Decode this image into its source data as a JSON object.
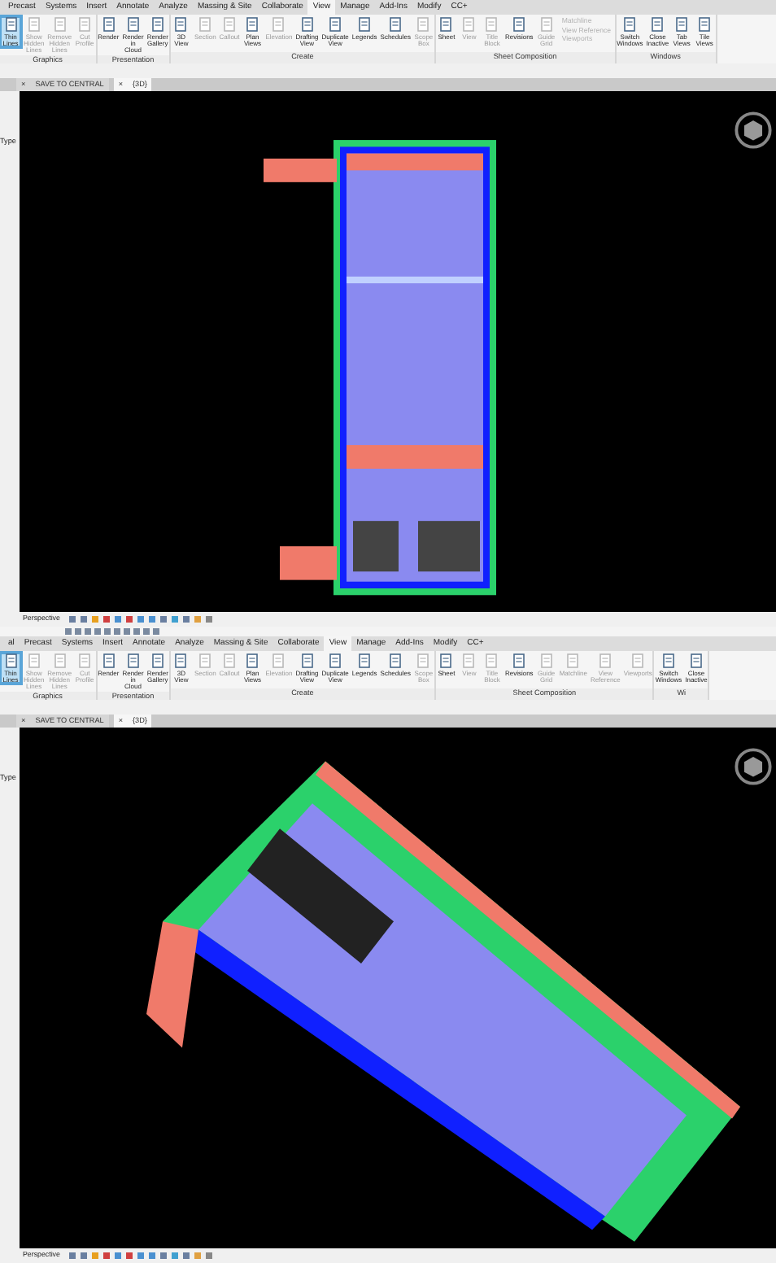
{
  "panels": [
    {
      "quick_access_bar": false,
      "ribbon_tabs": [
        {
          "label": "Precast",
          "selected": false
        },
        {
          "label": "Systems",
          "selected": false
        },
        {
          "label": "Insert",
          "selected": false
        },
        {
          "label": "Annotate",
          "selected": false
        },
        {
          "label": "Analyze",
          "selected": false
        },
        {
          "label": "Massing & Site",
          "selected": false
        },
        {
          "label": "Collaborate",
          "selected": false
        },
        {
          "label": "View",
          "selected": true
        },
        {
          "label": "Manage",
          "selected": false
        },
        {
          "label": "Add-Ins",
          "selected": false
        },
        {
          "label": "Modify",
          "selected": false
        },
        {
          "label": "CC+",
          "selected": false
        }
      ],
      "groups": [
        {
          "label": "Graphics",
          "buttons": [
            {
              "label": "Thin Lines",
              "kind": "large",
              "disabled": false,
              "on": true
            },
            {
              "label": "Show Hidden Lines",
              "kind": "large",
              "disabled": true,
              "on": false
            },
            {
              "label": "Remove Hidden Lines",
              "kind": "large",
              "disabled": true,
              "on": false
            },
            {
              "label": "Cut Profile",
              "kind": "large",
              "disabled": true,
              "on": false
            }
          ]
        },
        {
          "label": "Presentation",
          "buttons": [
            {
              "label": "Render",
              "kind": "large",
              "disabled": false,
              "on": false
            },
            {
              "label": "Render in Cloud",
              "kind": "large",
              "disabled": false,
              "on": false
            },
            {
              "label": "Render Gallery",
              "kind": "large",
              "disabled": false,
              "on": false
            }
          ]
        },
        {
          "label": "Create",
          "buttons": [
            {
              "label": "3D View",
              "kind": "large",
              "disabled": false,
              "on": false
            },
            {
              "label": "Section",
              "kind": "large",
              "disabled": true,
              "on": false
            },
            {
              "label": "Callout",
              "kind": "large",
              "disabled": true,
              "on": false
            },
            {
              "label": "Plan Views",
              "kind": "large",
              "disabled": false,
              "on": false
            },
            {
              "label": "Elevation",
              "kind": "large",
              "disabled": true,
              "on": false
            },
            {
              "label": "Drafting View",
              "kind": "large",
              "disabled": false,
              "on": false
            },
            {
              "label": "Duplicate View",
              "kind": "large",
              "disabled": false,
              "on": false
            },
            {
              "label": "Legends",
              "kind": "large",
              "disabled": false,
              "on": false
            },
            {
              "label": "Schedules",
              "kind": "large",
              "disabled": false,
              "on": false
            },
            {
              "label": "Scope Box",
              "kind": "large",
              "disabled": true,
              "on": false
            }
          ]
        },
        {
          "label": "Sheet Composition",
          "buttons": [
            {
              "label": "Sheet",
              "kind": "large",
              "disabled": false,
              "on": false
            },
            {
              "label": "View",
              "kind": "large",
              "disabled": true,
              "on": false
            },
            {
              "label": "Title Block",
              "kind": "large",
              "disabled": true,
              "on": false
            },
            {
              "label": "Revisions",
              "kind": "large",
              "disabled": false,
              "on": false
            },
            {
              "label": "Guide Grid",
              "kind": "large",
              "disabled": true,
              "on": false
            },
            {
              "label": "Matchline",
              "kind": "small",
              "disabled": true,
              "on": false
            },
            {
              "label": "View Reference",
              "kind": "small",
              "disabled": true,
              "on": false
            },
            {
              "label": "Viewports",
              "kind": "small",
              "disabled": true,
              "on": false
            }
          ]
        },
        {
          "label": "Windows",
          "buttons": [
            {
              "label": "Switch Windows",
              "kind": "large",
              "disabled": false,
              "on": false
            },
            {
              "label": "Close Inactive",
              "kind": "large",
              "disabled": false,
              "on": false
            },
            {
              "label": "Tab Views",
              "kind": "large",
              "disabled": false,
              "on": false
            },
            {
              "label": "Tile Views",
              "kind": "large",
              "disabled": false,
              "on": false
            }
          ]
        }
      ],
      "view_tabs": [
        {
          "label": "SAVE TO CENTRAL",
          "close": "×",
          "selected": false
        },
        {
          "label": "{3D}",
          "close": "×",
          "selected": true
        }
      ],
      "properties_label": "Type",
      "kind": "plan",
      "status_bar": {
        "view_style": "Perspective"
      }
    },
    {
      "quick_access_bar": true,
      "ribbon_tabs": [
        {
          "label": "al",
          "selected": false
        },
        {
          "label": "Precast",
          "selected": false
        },
        {
          "label": "Systems",
          "selected": false
        },
        {
          "label": "Insert",
          "selected": false
        },
        {
          "label": "Annotate",
          "selected": false
        },
        {
          "label": "Analyze",
          "selected": false
        },
        {
          "label": "Massing & Site",
          "selected": false
        },
        {
          "label": "Collaborate",
          "selected": false
        },
        {
          "label": "View",
          "selected": true
        },
        {
          "label": "Manage",
          "selected": false
        },
        {
          "label": "Add-Ins",
          "selected": false
        },
        {
          "label": "Modify",
          "selected": false
        },
        {
          "label": "CC+",
          "selected": false
        }
      ],
      "groups": [
        {
          "label": "Graphics",
          "buttons": [
            {
              "label": "Thin Lines",
              "kind": "large",
              "disabled": false,
              "on": true
            },
            {
              "label": "Show Hidden Lines",
              "kind": "large",
              "disabled": true,
              "on": false
            },
            {
              "label": "Remove Hidden Lines",
              "kind": "large",
              "disabled": true,
              "on": false
            },
            {
              "label": "Cut Profile",
              "kind": "large",
              "disabled": true,
              "on": false
            }
          ]
        },
        {
          "label": "Presentation",
          "buttons": [
            {
              "label": "Render",
              "kind": "large",
              "disabled": false,
              "on": false
            },
            {
              "label": "Render in Cloud",
              "kind": "large",
              "disabled": false,
              "on": false
            },
            {
              "label": "Render Gallery",
              "kind": "large",
              "disabled": false,
              "on": false
            }
          ]
        },
        {
          "label": "Create",
          "buttons": [
            {
              "label": "3D View",
              "kind": "large",
              "disabled": false,
              "on": false
            },
            {
              "label": "Section",
              "kind": "large",
              "disabled": true,
              "on": false
            },
            {
              "label": "Callout",
              "kind": "large",
              "disabled": true,
              "on": false
            },
            {
              "label": "Plan Views",
              "kind": "large",
              "disabled": false,
              "on": false
            },
            {
              "label": "Elevation",
              "kind": "large",
              "disabled": true,
              "on": false
            },
            {
              "label": "Drafting View",
              "kind": "large",
              "disabled": false,
              "on": false
            },
            {
              "label": "Duplicate View",
              "kind": "large",
              "disabled": false,
              "on": false
            },
            {
              "label": "Legends",
              "kind": "large",
              "disabled": false,
              "on": false
            },
            {
              "label": "Schedules",
              "kind": "large",
              "disabled": false,
              "on": false
            },
            {
              "label": "Scope Box",
              "kind": "large",
              "disabled": true,
              "on": false
            }
          ]
        },
        {
          "label": "Sheet Composition",
          "buttons": [
            {
              "label": "Sheet",
              "kind": "large",
              "disabled": false,
              "on": false
            },
            {
              "label": "View",
              "kind": "large",
              "disabled": true,
              "on": false
            },
            {
              "label": "Title Block",
              "kind": "large",
              "disabled": true,
              "on": false
            },
            {
              "label": "Revisions",
              "kind": "large",
              "disabled": false,
              "on": false
            },
            {
              "label": "Guide Grid",
              "kind": "large",
              "disabled": true,
              "on": false
            },
            {
              "label": "Matchline",
              "kind": "large",
              "disabled": true,
              "on": false
            },
            {
              "label": "View Reference",
              "kind": "large",
              "disabled": true,
              "on": false
            },
            {
              "label": "Viewports",
              "kind": "large",
              "disabled": true,
              "on": false
            }
          ]
        },
        {
          "label": "Wi",
          "buttons": [
            {
              "label": "Switch Windows",
              "kind": "large",
              "disabled": false,
              "on": false
            },
            {
              "label": "Close Inactive",
              "kind": "large",
              "disabled": false,
              "on": false
            }
          ]
        }
      ],
      "view_tabs": [
        {
          "label": "SAVE TO CENTRAL",
          "close": "×",
          "selected": false
        },
        {
          "label": "{3D}",
          "close": "×",
          "selected": true
        }
      ],
      "properties_label": "Type",
      "kind": "isometric",
      "status_bar": {
        "view_style": "Perspective"
      }
    }
  ]
}
